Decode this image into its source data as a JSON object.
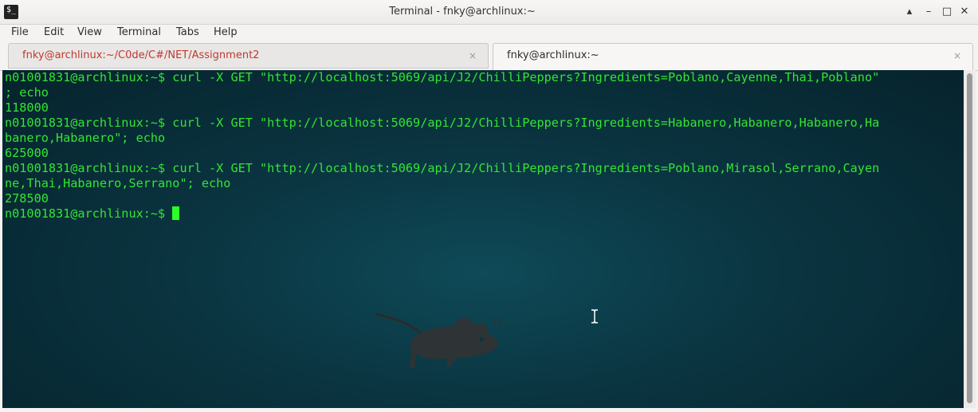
{
  "window": {
    "title": "Terminal - fnky@archlinux:~",
    "controls": {
      "keep_above": "▴",
      "minimize": "–",
      "maximize": "□",
      "close": "✕"
    }
  },
  "menu": [
    "File",
    "Edit",
    "View",
    "Terminal",
    "Tabs",
    "Help"
  ],
  "tabs": [
    {
      "label": "fnky@archlinux:~/C0de/C#/NET/Assignment2",
      "close": "×",
      "active": false
    },
    {
      "label": "fnky@archlinux:~",
      "close": "×",
      "active": true
    }
  ],
  "terminal": {
    "lines": [
      "n01001831@archlinux:~$ curl -X GET \"http://localhost:5069/api/J2/ChilliPeppers?Ingredients=Poblano,Cayenne,Thai,Poblano\"",
      "; echo",
      "118000",
      "n01001831@archlinux:~$ curl -X GET \"http://localhost:5069/api/J2/ChilliPeppers?Ingredients=Habanero,Habanero,Habanero,Ha",
      "banero,Habanero\"; echo",
      "625000",
      "n01001831@archlinux:~$ curl -X GET \"http://localhost:5069/api/J2/ChilliPeppers?Ingredients=Poblano,Mirasol,Serrano,Cayen",
      "ne,Thai,Habanero,Serrano\"; echo",
      "278500"
    ],
    "prompt": "n01001831@archlinux:~$ ",
    "text_color": "#33e533",
    "background_color": "#0a3440"
  },
  "icons": {
    "app": "terminal-icon",
    "background": "xfce-mouse-logo",
    "pointer": "ibeam-cursor-icon"
  }
}
